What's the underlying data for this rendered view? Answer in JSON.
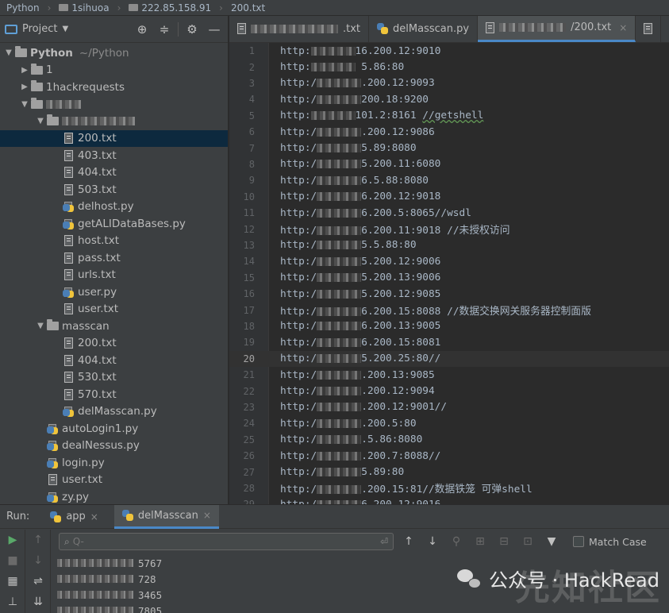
{
  "breadcrumb": [
    "Python",
    "1sihuoa",
    "222.85.158.91",
    "200.txt"
  ],
  "project_panel": {
    "title": "Project",
    "tree": [
      {
        "label": "Python",
        "suffix": "~/Python",
        "type": "folder",
        "indent": 0,
        "open": true,
        "bold": true
      },
      {
        "label": "1",
        "type": "folder",
        "indent": 1,
        "open": false
      },
      {
        "label": "1hackrequests",
        "type": "folder",
        "indent": 1,
        "open": false
      },
      {
        "label": "",
        "type": "folder",
        "indent": 1,
        "open": true,
        "redacted_width": 44
      },
      {
        "label": "",
        "type": "folder",
        "indent": 2,
        "open": true,
        "redacted_width": 92
      },
      {
        "label": "200.txt",
        "type": "txt",
        "indent": 3,
        "selected": true
      },
      {
        "label": "403.txt",
        "type": "txt",
        "indent": 3
      },
      {
        "label": "404.txt",
        "type": "txt",
        "indent": 3
      },
      {
        "label": "503.txt",
        "type": "txt",
        "indent": 3
      },
      {
        "label": "delhost.py",
        "type": "py",
        "indent": 3
      },
      {
        "label": "getALIDataBases.py",
        "type": "py",
        "indent": 3
      },
      {
        "label": "host.txt",
        "type": "txt",
        "indent": 3
      },
      {
        "label": "pass.txt",
        "type": "txt",
        "indent": 3
      },
      {
        "label": "urls.txt",
        "type": "txt",
        "indent": 3
      },
      {
        "label": "user.py",
        "type": "py",
        "indent": 3
      },
      {
        "label": "user.txt",
        "type": "txt",
        "indent": 3
      },
      {
        "label": "masscan",
        "type": "folder",
        "indent": 2,
        "open": true
      },
      {
        "label": "200.txt",
        "type": "txt",
        "indent": 3
      },
      {
        "label": "404.txt",
        "type": "txt",
        "indent": 3
      },
      {
        "label": "530.txt",
        "type": "txt",
        "indent": 3
      },
      {
        "label": "570.txt",
        "type": "txt",
        "indent": 3
      },
      {
        "label": "delMasscan.py",
        "type": "py",
        "indent": 3
      },
      {
        "label": "autoLogin1.py",
        "type": "py",
        "indent": 2
      },
      {
        "label": "dealNessus.py",
        "type": "py",
        "indent": 2
      },
      {
        "label": "login.py",
        "type": "py",
        "indent": 2
      },
      {
        "label": "user.txt",
        "type": "txt",
        "indent": 2
      },
      {
        "label": "zy.py",
        "type": "py",
        "indent": 2
      }
    ]
  },
  "editor": {
    "tabs": [
      {
        "label": ".txt",
        "type": "txt",
        "active": false,
        "redacted_width": 110
      },
      {
        "label": "delMasscan.py",
        "type": "py",
        "active": false
      },
      {
        "label": "/200.txt",
        "type": "txt",
        "active": true,
        "redacted_width": 84,
        "close": "×"
      }
    ],
    "current_line": 20,
    "lines": [
      {
        "n": 1,
        "pre": "http:",
        "post": "16.200.12:9010"
      },
      {
        "n": 2,
        "pre": "http:",
        "post": " 5.86:80"
      },
      {
        "n": 3,
        "pre": "http:/",
        "post": ".200.12:9093"
      },
      {
        "n": 4,
        "pre": "http:/",
        "post": "200.18:9200"
      },
      {
        "n": 5,
        "pre": "http:",
        "post": "101.2:8161 ",
        "comment": "//getshell"
      },
      {
        "n": 6,
        "pre": "http:/",
        "post": ".200.12:9086"
      },
      {
        "n": 7,
        "pre": "http:/",
        "post": "5.89:8080"
      },
      {
        "n": 8,
        "pre": "http:/",
        "post": "5.200.11:6080"
      },
      {
        "n": 9,
        "pre": "http:/",
        "post": "6.5.88:8080"
      },
      {
        "n": 10,
        "pre": "http:/",
        "post": "6.200.12:9018"
      },
      {
        "n": 11,
        "pre": "http:/",
        "post": "6.200.5:8065//wsdl"
      },
      {
        "n": 12,
        "pre": "http:/",
        "post": "6.200.11:9018 ",
        "comment": "//未授权访问"
      },
      {
        "n": 13,
        "pre": "http:/",
        "post": "5.5.88:80"
      },
      {
        "n": 14,
        "pre": "http:/",
        "post": "5.200.12:9006"
      },
      {
        "n": 15,
        "pre": "http:/",
        "post": "5.200.13:9006"
      },
      {
        "n": 16,
        "pre": "http:/",
        "post": "5.200.12:9085"
      },
      {
        "n": 17,
        "pre": "http:/",
        "post": "6.200.15:8088 ",
        "comment": "//数据交换网关服务器控制面版"
      },
      {
        "n": 18,
        "pre": "http:/",
        "post": "6.200.13:9005"
      },
      {
        "n": 19,
        "pre": "http:/",
        "post": "6.200.15:8081"
      },
      {
        "n": 20,
        "pre": "http:/",
        "post": "5.200.25:80//"
      },
      {
        "n": 21,
        "pre": "http:/",
        "post": ".200.13:9085"
      },
      {
        "n": 22,
        "pre": "http:/",
        "post": ".200.12:9094"
      },
      {
        "n": 23,
        "pre": "http:/",
        "post": ".200.12:9001//"
      },
      {
        "n": 24,
        "pre": "http:/",
        "post": ".200.5:80"
      },
      {
        "n": 25,
        "pre": "http:/",
        "post": ".5.86:8080"
      },
      {
        "n": 26,
        "pre": "http:/",
        "post": ".200.7:8088//"
      },
      {
        "n": 27,
        "pre": "http:/",
        "post": "5.89:80"
      },
      {
        "n": 28,
        "pre": "http:/",
        "post": ".200.15:81//数据铁笼 可弹shell"
      },
      {
        "n": 29,
        "pre": "http:/",
        "post": "6.200.12:9016"
      }
    ]
  },
  "run_panel": {
    "label": "Run:",
    "tabs": [
      {
        "label": "app",
        "active": false
      },
      {
        "label": "delMasscan",
        "active": true
      }
    ],
    "search_placeholder": "Q-",
    "match_case": "Match Case",
    "output": [
      "5767",
      "728",
      "3465",
      "7805"
    ]
  },
  "watermark": {
    "text": "公众号 · HackRead",
    "bg_text": "先知社区"
  }
}
